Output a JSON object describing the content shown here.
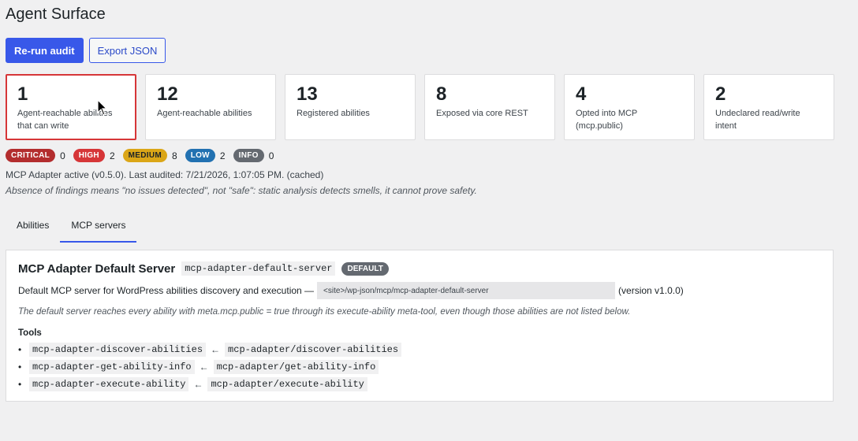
{
  "page": {
    "title": "Agent Surface"
  },
  "actions": {
    "rerun_label": "Re-run audit",
    "export_label": "Export JSON"
  },
  "cards": [
    {
      "value": "1",
      "label": "Agent-reachable abilities that can write",
      "highlight": true
    },
    {
      "value": "12",
      "label": "Agent-reachable abilities"
    },
    {
      "value": "13",
      "label": "Registered abilities"
    },
    {
      "value": "8",
      "label": "Exposed via core REST"
    },
    {
      "value": "4",
      "label": "Opted into MCP (mcp.public)"
    },
    {
      "value": "2",
      "label": "Undeclared read/write intent"
    }
  ],
  "severity": [
    {
      "label": "CRITICAL",
      "count": "0",
      "color": "#b32d2e"
    },
    {
      "label": "HIGH",
      "count": "2",
      "color": "#d63638"
    },
    {
      "label": "MEDIUM",
      "count": "8",
      "color": "#dba617"
    },
    {
      "label": "LOW",
      "count": "2",
      "color": "#2271b1"
    },
    {
      "label": "INFO",
      "count": "0",
      "color": "#646970"
    }
  ],
  "status": {
    "audit": "MCP Adapter active (v0.5.0). Last audited: 7/21/2026, 1:07:05 PM. (cached)",
    "disclaimer": "Absence of findings means \"no issues detected\", not \"safe\": static analysis detects smells, it cannot prove safety."
  },
  "tabs": [
    {
      "label": "Abilities",
      "active": false
    },
    {
      "label": "MCP servers",
      "active": true
    }
  ],
  "server": {
    "name": "MCP Adapter Default Server",
    "slug": "mcp-adapter-default-server",
    "badge": "DEFAULT",
    "description": "Default MCP server for WordPress abilities discovery and execution —",
    "endpoint": "<site>/wp-json/mcp/mcp-adapter-default-server",
    "version": "(version v1.0.0)",
    "note": "The default server reaches every ability with meta.mcp.public = true through its execute-ability meta-tool, even though those abilities are not listed below.",
    "tools_title": "Tools",
    "tools": [
      {
        "tool": "mcp-adapter-discover-abilities",
        "ability": "mcp-adapter/discover-abilities"
      },
      {
        "tool": "mcp-adapter-get-ability-info",
        "ability": "mcp-adapter/get-ability-info"
      },
      {
        "tool": "mcp-adapter-execute-ability",
        "ability": "mcp-adapter/execute-ability"
      }
    ],
    "arrow": "←",
    "bullet": "•"
  },
  "colors": {
    "accent": "#3858e9",
    "alert_border": "#d63638"
  },
  "icons": {
    "cursor": "mouse-pointer-icon"
  }
}
